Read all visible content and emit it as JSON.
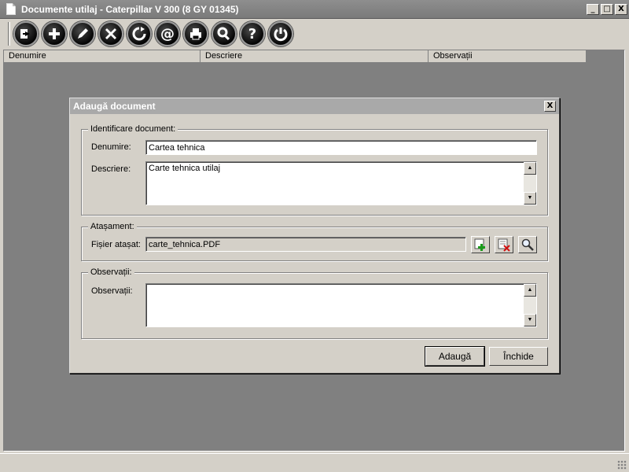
{
  "window": {
    "title": "Documente utilaj - Caterpillar  V 300 (8 GY 01345)",
    "controls": {
      "minimize": "_",
      "maximize": "□",
      "close": "X"
    }
  },
  "toolbar": {
    "buttons": [
      {
        "icon": "exit-icon"
      },
      {
        "icon": "add-icon"
      },
      {
        "icon": "edit-icon"
      },
      {
        "icon": "delete-icon"
      },
      {
        "icon": "refresh-icon"
      },
      {
        "icon": "email-icon",
        "glyph": "@"
      },
      {
        "icon": "print-icon"
      },
      {
        "icon": "search-icon"
      },
      {
        "icon": "help-icon",
        "glyph": "?"
      },
      {
        "icon": "power-icon"
      }
    ]
  },
  "grid": {
    "columns": [
      "Denumire",
      "Descriere",
      "Observații"
    ]
  },
  "dialog": {
    "title": "Adaugă document",
    "close": "X",
    "identification": {
      "legend": "Identificare document:",
      "name_label": "Denumire:",
      "name_value": "Cartea tehnica",
      "description_label": "Descriere:",
      "description_value": "Carte tehnica utilaj"
    },
    "attachment": {
      "legend": "Atașament:",
      "file_label": "Fișier atașat:",
      "file_value": "carte_tehnica.PDF"
    },
    "notes": {
      "legend": "Observații:",
      "label": "Observații:",
      "value": ""
    },
    "buttons": {
      "add": "Adaugă",
      "close": "Închide"
    }
  },
  "colors": {
    "titlebar": "#7a7a7a",
    "background": "#d4d0c8",
    "workspace": "#808080",
    "dialog_title": "#a9a9a9"
  }
}
